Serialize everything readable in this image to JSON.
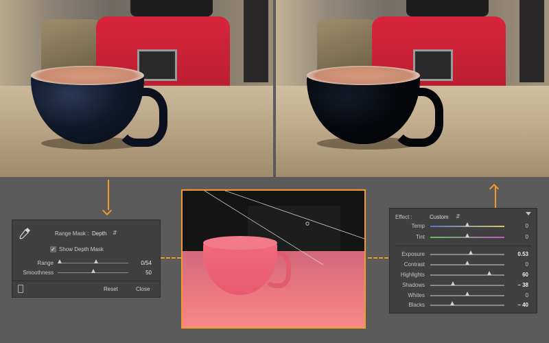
{
  "range_mask_panel": {
    "range_mask_label": "Range Mask :",
    "range_mask_value": "Depth",
    "show_depth_mask_label": "Show Depth Mask",
    "show_depth_mask_checked": true,
    "range_label": "Range",
    "range_value": "0/54",
    "smoothness_label": "Smoothness",
    "smoothness_value": "50",
    "reset_label": "Reset",
    "close_label": "Close"
  },
  "effect_panel": {
    "effect_label": "Effect :",
    "effect_value": "Custom",
    "sliders": [
      {
        "label": "Temp",
        "value": "0",
        "level": 0.5
      },
      {
        "label": "Tint",
        "value": "0",
        "level": 0.5
      },
      {
        "label": "Exposure",
        "value": "0.53",
        "level": 0.55
      },
      {
        "label": "Contrast",
        "value": "0",
        "level": 0.5
      },
      {
        "label": "Highlights",
        "value": "60",
        "level": 0.8
      },
      {
        "label": "Shadows",
        "value": "– 38",
        "level": 0.31
      },
      {
        "label": "Whites",
        "value": "0",
        "level": 0.5
      },
      {
        "label": "Blacks",
        "value": "– 40",
        "level": 0.3
      }
    ]
  },
  "colors": {
    "accent_orange": "#f29a2a",
    "panel_bg": "#404040",
    "depth_mask": "#f07a82"
  },
  "icons": {
    "eyedropper": "eyedropper-icon",
    "phone": "phone-icon",
    "collapse": "triangle-down-icon"
  }
}
